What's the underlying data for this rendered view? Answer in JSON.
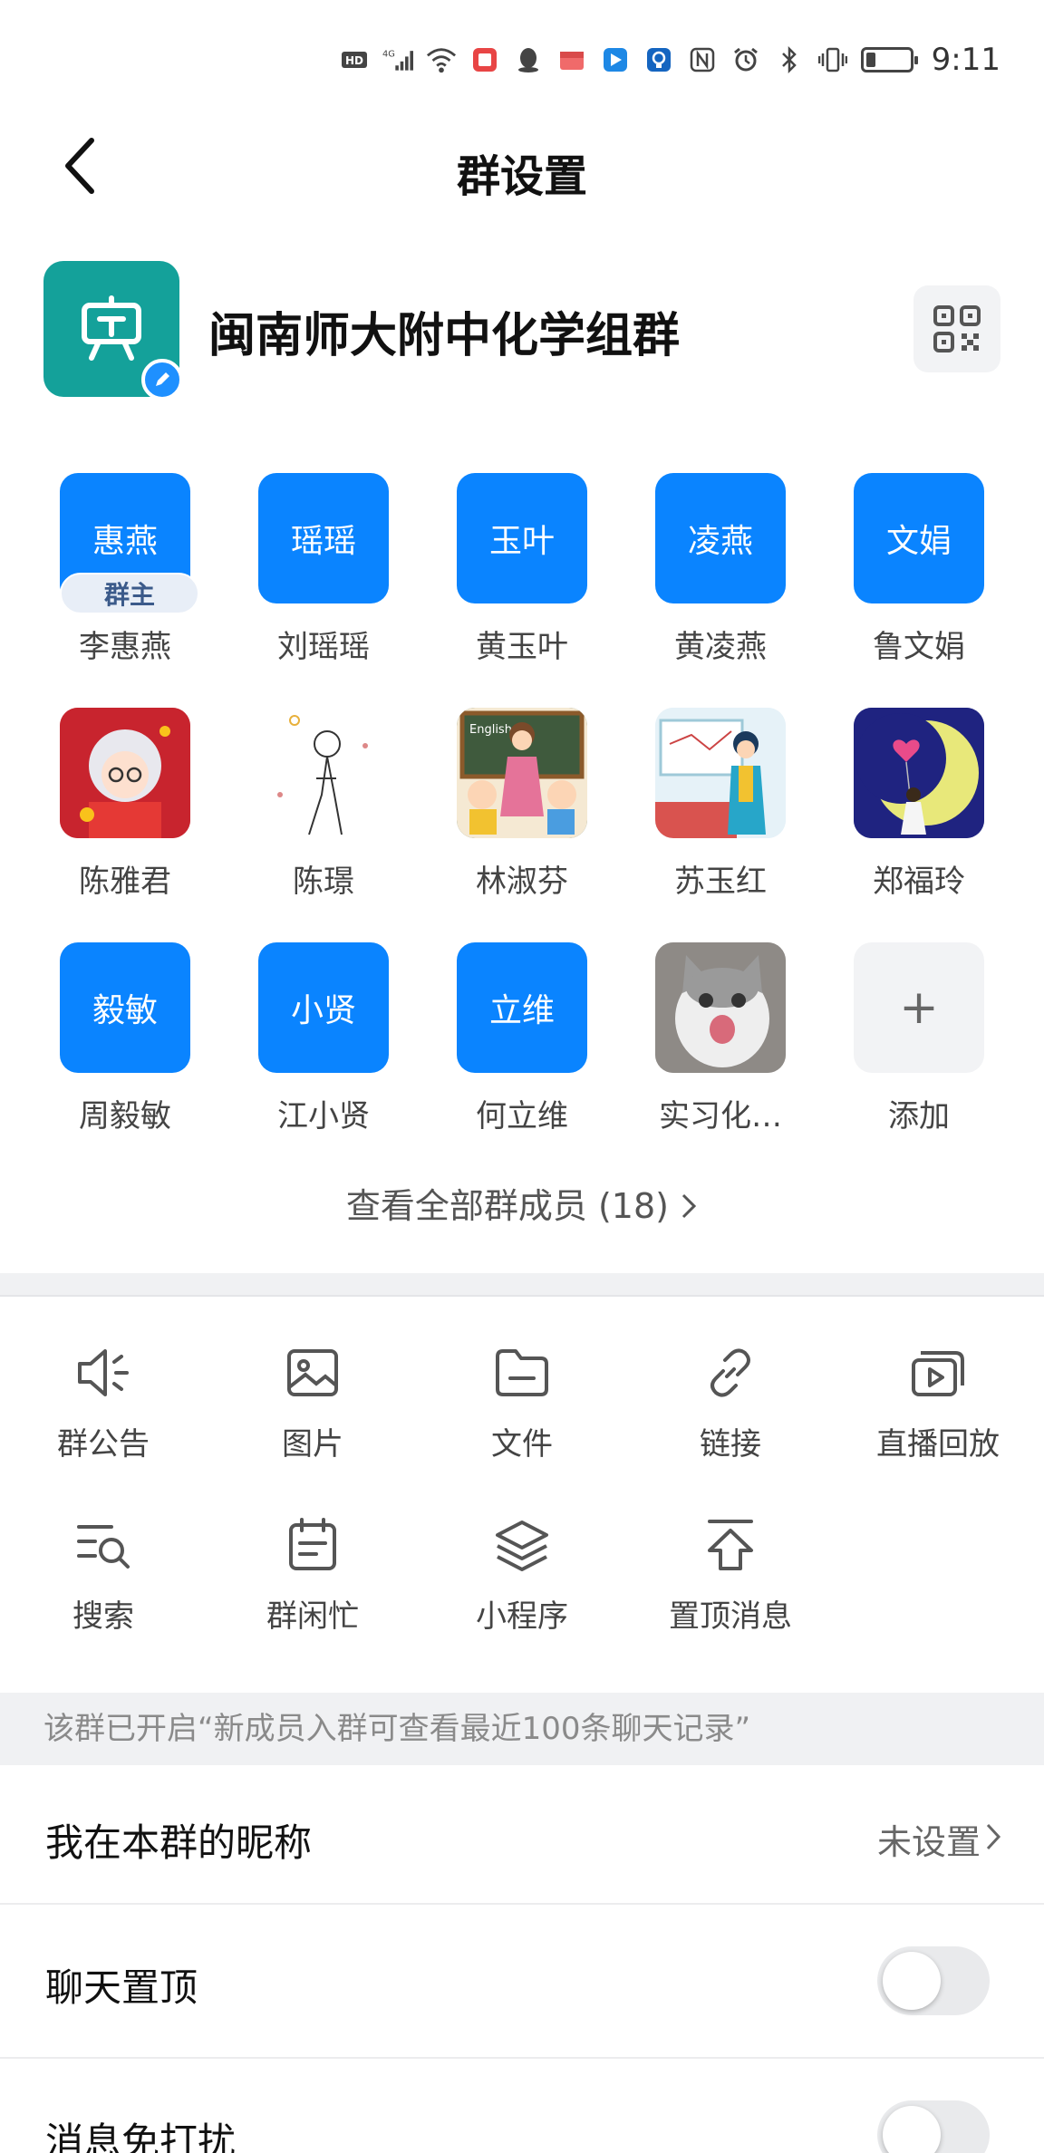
{
  "status_bar": {
    "time": "9:11",
    "icons": [
      "hd-icon",
      "signal-4g-icon",
      "wifi-icon",
      "app-notification-icon",
      "qq-icon",
      "app-notification-icon",
      "app-notification-icon",
      "app-notification-icon",
      "nfc-icon",
      "alarm-icon",
      "bluetooth-icon",
      "vibrate-icon",
      "battery-icon"
    ],
    "battery_level": 0.2
  },
  "header": {
    "title": "群设置"
  },
  "group": {
    "name": "闽南师大附中化学组群"
  },
  "members": [
    {
      "avatar_text": "惠燕",
      "name": "李惠燕",
      "badge": "群主",
      "type": "text"
    },
    {
      "avatar_text": "瑶瑶",
      "name": "刘瑶瑶",
      "type": "text"
    },
    {
      "avatar_text": "玉叶",
      "name": "黄玉叶",
      "type": "text"
    },
    {
      "avatar_text": "凌燕",
      "name": "黄凌燕",
      "type": "text"
    },
    {
      "avatar_text": "文娟",
      "name": "鲁文娟",
      "type": "text"
    },
    {
      "name": "陈雅君",
      "type": "image",
      "image": "cartoon-grandma-avatar"
    },
    {
      "name": "陈璟",
      "type": "image",
      "image": "sketch-girl-avatar"
    },
    {
      "name": "林淑芬",
      "type": "image",
      "image": "teacher-kids-avatar"
    },
    {
      "name": "苏玉红",
      "type": "image",
      "image": "teacher-board-avatar"
    },
    {
      "name": "郑福玲",
      "type": "image",
      "image": "moon-girl-avatar"
    },
    {
      "avatar_text": "毅敏",
      "name": "周毅敏",
      "type": "text"
    },
    {
      "avatar_text": "小贤",
      "name": "江小贤",
      "type": "text"
    },
    {
      "avatar_text": "立维",
      "name": "何立维",
      "type": "text"
    },
    {
      "name": "实习化…",
      "type": "image",
      "image": "cat-avatar"
    },
    {
      "avatar_text": "+",
      "name": "添加",
      "type": "add"
    }
  ],
  "view_all": "查看全部群成员 (18)",
  "tools": [
    {
      "label": "群公告",
      "icon": "announcement-icon"
    },
    {
      "label": "图片",
      "icon": "image-icon"
    },
    {
      "label": "文件",
      "icon": "folder-icon"
    },
    {
      "label": "链接",
      "icon": "link-icon"
    },
    {
      "label": "直播回放",
      "icon": "replay-icon"
    },
    {
      "label": "搜索",
      "icon": "search-list-icon"
    },
    {
      "label": "群闲忙",
      "icon": "calendar-icon"
    },
    {
      "label": "小程序",
      "icon": "layers-icon"
    },
    {
      "label": "置顶消息",
      "icon": "pin-top-icon"
    }
  ],
  "notice": "该群已开启“新成员入群可查看最近100条聊天记录”",
  "settings": {
    "nickname": {
      "label": "我在本群的昵称",
      "value": "未设置"
    },
    "pin_chat": {
      "label": "聊天置顶",
      "on": false
    },
    "do_not_disturb": {
      "label": "消息免打扰",
      "on": false
    }
  }
}
